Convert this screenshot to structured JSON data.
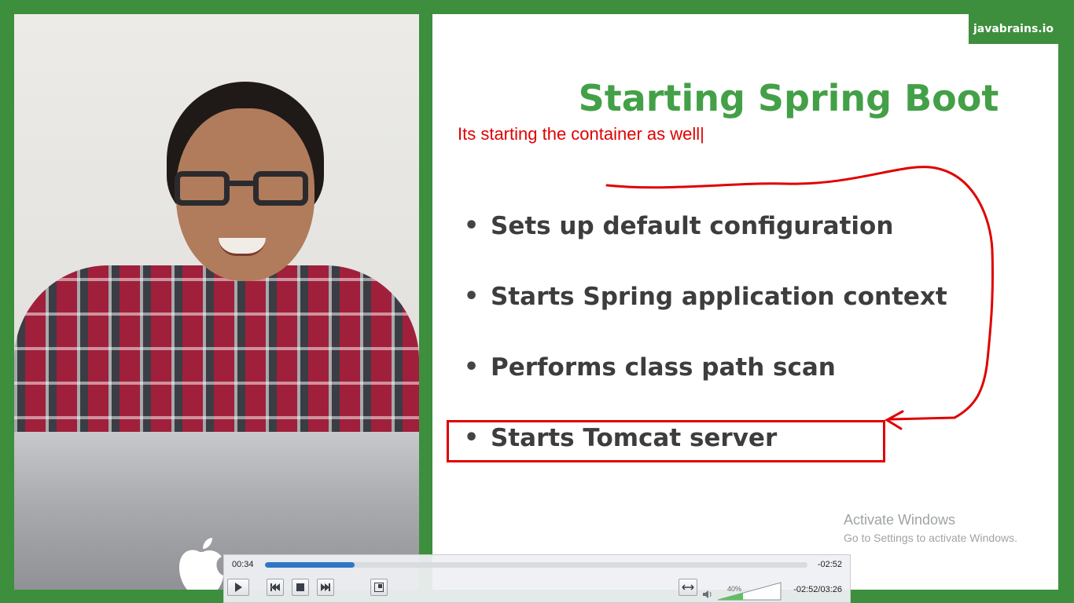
{
  "slide": {
    "brand": "javabrains.io",
    "title": "Starting Spring Boot",
    "annotation": "Its starting the container as well|",
    "bullets": [
      "Sets up default configuration",
      "Starts Spring application context",
      "Performs class path scan",
      "Starts Tomcat server"
    ],
    "highlighted_bullet_index": 3,
    "title_color": "#43a047",
    "annotation_color": "#e00000"
  },
  "watermark": {
    "line1": "Activate Windows",
    "line2": "Go to Settings to activate Windows."
  },
  "player": {
    "elapsed": "00:34",
    "remaining": "-02:52",
    "time_display": "-02:52/03:26",
    "progress": 0.165,
    "volume_label": "40%",
    "volume": 0.4,
    "buttons": [
      "play-icon",
      "previous-icon",
      "stop-icon",
      "next-icon",
      "fullscreen-icon",
      "aspect-ratio-icon",
      "speaker-icon"
    ]
  },
  "colors": {
    "background_green": "#3d8f3d",
    "seek_fill": "#2f76c6"
  }
}
